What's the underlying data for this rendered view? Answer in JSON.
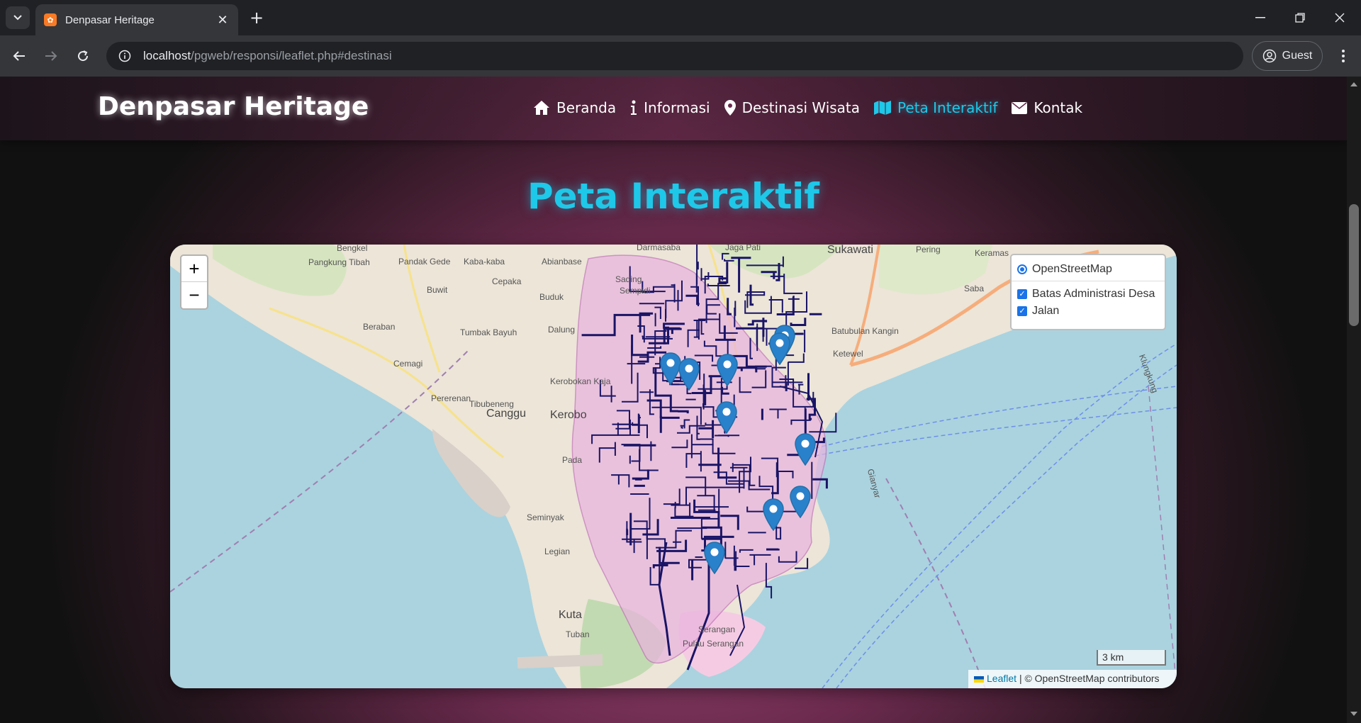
{
  "browser": {
    "tab_title": "Denpasar Heritage",
    "url_host": "localhost",
    "url_path": "/pgweb/responsi/leaflet.php#destinasi",
    "profile_label": "Guest"
  },
  "site": {
    "brand": "Denpasar Heritage",
    "nav": [
      {
        "label": "Beranda",
        "icon": "home-icon"
      },
      {
        "label": "Informasi",
        "icon": "info-icon"
      },
      {
        "label": "Destinasi Wisata",
        "icon": "map-pin-icon"
      },
      {
        "label": "Peta Interaktif",
        "icon": "map-icon",
        "active": true
      },
      {
        "label": "Kontak",
        "icon": "envelope-icon"
      }
    ],
    "section_title": "Peta Interaktif",
    "accent_color": "#1ec8e8"
  },
  "map": {
    "zoom_in": "+",
    "zoom_out": "−",
    "layers": {
      "base": "OpenStreetMap",
      "overlays": [
        "Batas Administrasi Desa",
        "Jalan"
      ]
    },
    "scale": "3 km",
    "attribution_link": "Leaflet",
    "attribution_text": "| © OpenStreetMap contributors",
    "places": [
      {
        "name": "Bengkel"
      },
      {
        "name": "Pangkung Tibah"
      },
      {
        "name": "Pandak Gede"
      },
      {
        "name": "Kaba-kaba"
      },
      {
        "name": "Abianbase"
      },
      {
        "name": "Darmasaba"
      },
      {
        "name": "Jaga Pati"
      },
      {
        "name": "Sukawati"
      },
      {
        "name": "Pering"
      },
      {
        "name": "Keramas"
      },
      {
        "name": "Buwit"
      },
      {
        "name": "Cepaka"
      },
      {
        "name": "Sading"
      },
      {
        "name": "Sempidi"
      },
      {
        "name": "Buduk"
      },
      {
        "name": "Saba"
      },
      {
        "name": "Beraban"
      },
      {
        "name": "Tumbak Bayuh"
      },
      {
        "name": "Dalung"
      },
      {
        "name": "Batubulan Kangin"
      },
      {
        "name": "Ketewel"
      },
      {
        "name": "Cemagi"
      },
      {
        "name": "Pererenan"
      },
      {
        "name": "Kerobokan Kaja"
      },
      {
        "name": "Tibubeneng"
      },
      {
        "name": "Canggu"
      },
      {
        "name": "Kerobo"
      },
      {
        "name": "Pada"
      },
      {
        "name": "Seminyak"
      },
      {
        "name": "Legian"
      },
      {
        "name": "Kuta"
      },
      {
        "name": "Tuban"
      },
      {
        "name": "Serangan"
      },
      {
        "name": "Pulau Serangan"
      },
      {
        "name": "Gianyar"
      },
      {
        "name": "Klungkung"
      }
    ],
    "markers_count": 10
  }
}
